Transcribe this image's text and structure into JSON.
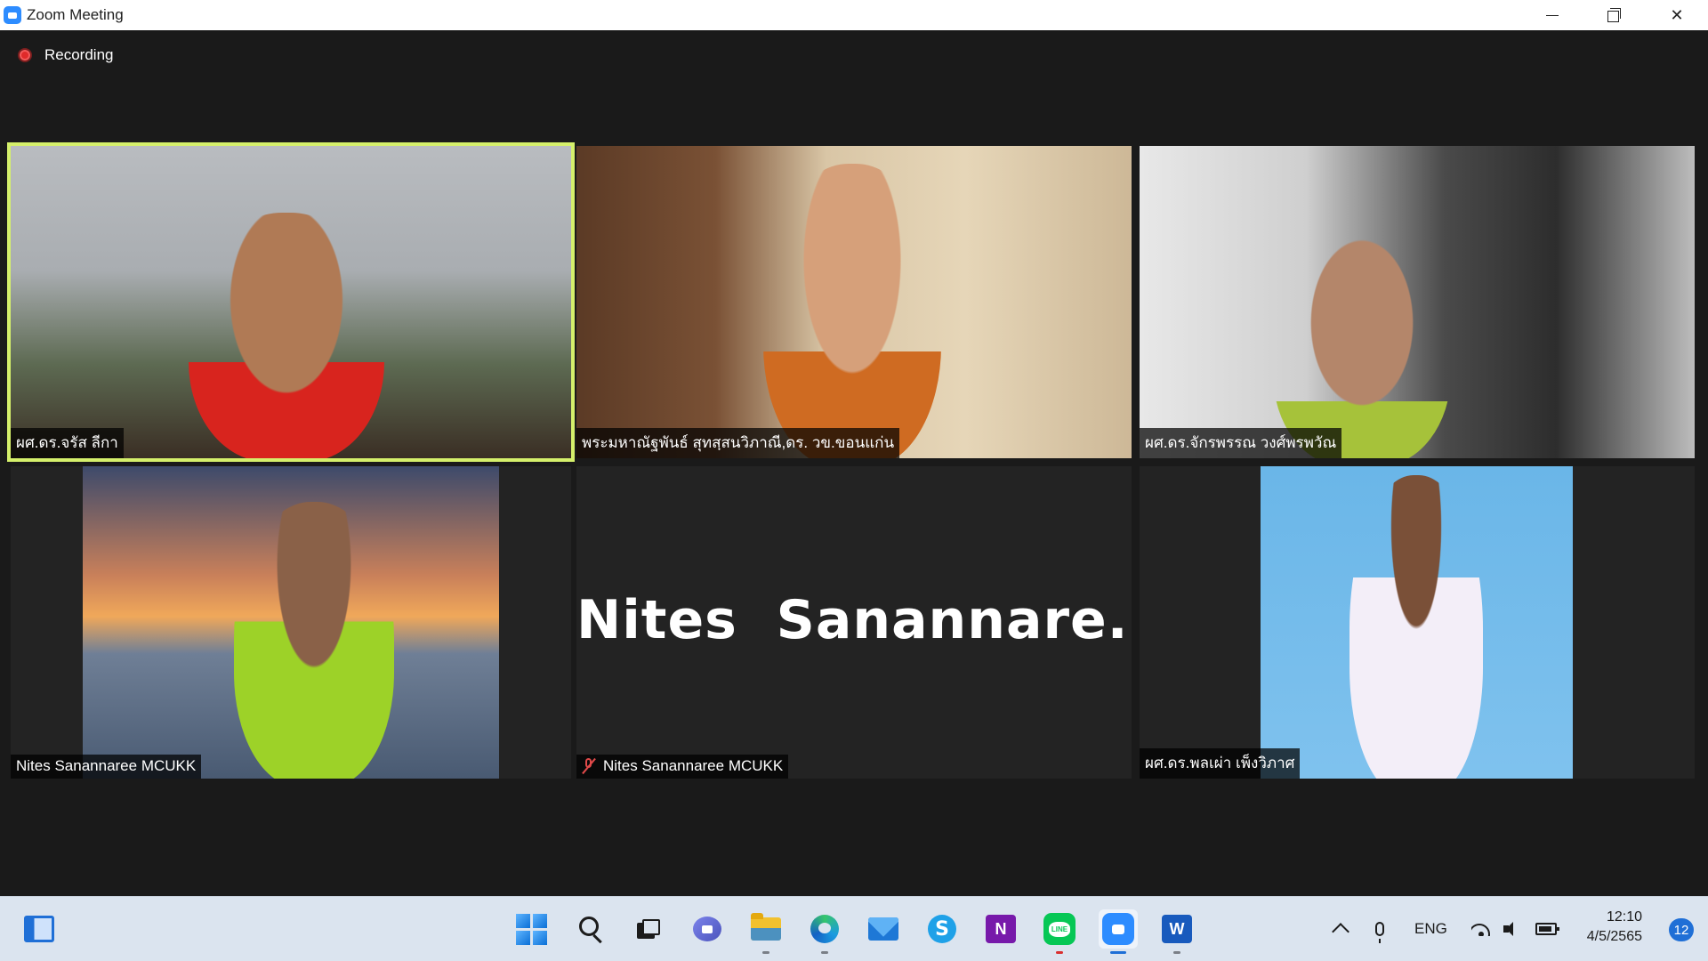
{
  "window": {
    "title": "Zoom Meeting"
  },
  "recording": {
    "label": "Recording"
  },
  "participants": [
    {
      "name": "ผศ.ดร.จรัส ลีกา",
      "active": true,
      "video": true
    },
    {
      "name": "พระมหาณัฐพันธ์ สุทสฺสนวิภาณี,ดร. วข.ขอนแก่น",
      "active": false,
      "video": true
    },
    {
      "name": "ผศ.ดร.จักรพรรณ วงศ์พรพวัณ",
      "active": false,
      "video": true
    },
    {
      "name": "Nites Sanannaree MCUKK",
      "active": false,
      "video": true
    },
    {
      "name": "Nites Sanannaree MCUKK",
      "active": false,
      "video": false,
      "muted": true,
      "display_name": "Nites  Sanannare..."
    },
    {
      "name": "ผศ.ดร.พลเผ่า เพ็งวิภาศ",
      "active": false,
      "video": true
    }
  ],
  "taskbar": {
    "apps": [
      "widgets-icon",
      "start-icon",
      "search-icon",
      "task-view-icon",
      "chat-icon",
      "file-explorer-icon",
      "edge-icon",
      "mail-icon",
      "skype-icon",
      "onenote-icon",
      "line-icon",
      "zoom-icon",
      "word-icon"
    ],
    "onenote_letter": "N",
    "word_letter": "W",
    "skype_letter": "S",
    "language": "ENG",
    "time": "12:10",
    "date": "4/5/2565",
    "notifications": "12"
  }
}
